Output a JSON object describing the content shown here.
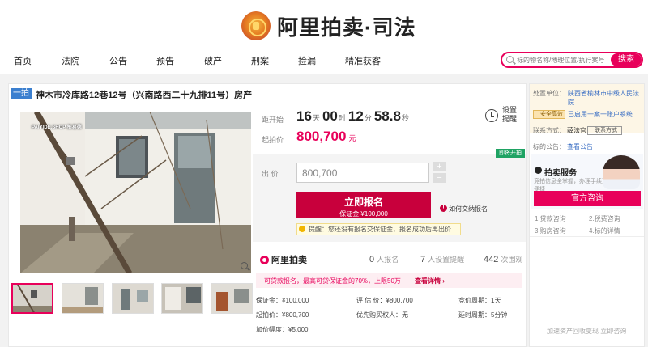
{
  "brand": {
    "name": "阿里拍卖·司法"
  },
  "nav": {
    "items": [
      "首页",
      "法院",
      "公告",
      "预告",
      "破产",
      "刑案",
      "捡漏",
      "精准获客"
    ],
    "search_placeholder": "标的物名称/地理位置/执行案号",
    "search_button": "搜索"
  },
  "listing": {
    "tag": "一拍",
    "title": "神木市冷库路12巷12号（兴南路西二十九排11号）房产"
  },
  "auction": {
    "countdown_label": "距开始",
    "days": "16",
    "days_unit": "天",
    "hours": "00",
    "hours_unit": "时",
    "minutes": "12",
    "minutes_unit": "分",
    "seconds": "58.8",
    "seconds_unit": "秒",
    "reminder_label": "设置提醒",
    "start_price_label": "起拍价",
    "start_price": "800,700",
    "start_price_unit": "元",
    "upcoming_badge": "即将开拍",
    "bid_label": "出  价",
    "bid_value": "800,700",
    "apply_button": "立即报名",
    "deposit_note": "保证金 ¥100,000",
    "how_to_link": "如何交纳报名",
    "tip": "提醒：您还没有报名交保证金，报名成功后再出价"
  },
  "stats": {
    "platform": "阿里拍卖",
    "signups_count": "0",
    "signups_label": "人报名",
    "watchers_count": "7",
    "watchers_label": "人设置提醒",
    "views_count": "442",
    "views_label": "次围观"
  },
  "loan": {
    "text": "可贷款报名，最高可贷保证金的70%，上限50万",
    "link": "查看详情 ›"
  },
  "details": {
    "deposit": "保证金：¥100,000",
    "appraisal": "评 估 价：¥800,700",
    "bid_cycle": "竞价周期：1天",
    "start_price": "起拍价：¥800,700",
    "priority": "优先购买权人：无",
    "delay": "延时周期：5分钟",
    "increment": "加价幅度：¥5,000"
  },
  "court": {
    "unit_label": "处置单位：",
    "unit": "陕西省榆林市中级人民法院",
    "safe_badge": "安全高效",
    "linked_text": "已启用一案一账户系统",
    "contact_label": "联系方式：",
    "contact_name": "薛法官",
    "chat_badge": "联系方式",
    "notice_label": "标的公告：",
    "notice_link": "查看公告"
  },
  "service": {
    "title": "拍卖服务",
    "desc": "竞拍信息全掌握，办理手续更便捷",
    "consult_button": "官方咨询",
    "items": [
      "1.贷款咨询",
      "2.税费咨询",
      "3.购房咨询",
      "4.标的详情"
    ]
  },
  "footer_ad": {
    "text": "加速资产回收变现 立即咨询"
  },
  "colors": {
    "accent": "#e8005a",
    "primary_button": "#c8003c",
    "upcoming": "#1fa363",
    "tag": "#3b7fcf"
  },
  "watermark": "PAIYIDE.SHOP 拍易德"
}
